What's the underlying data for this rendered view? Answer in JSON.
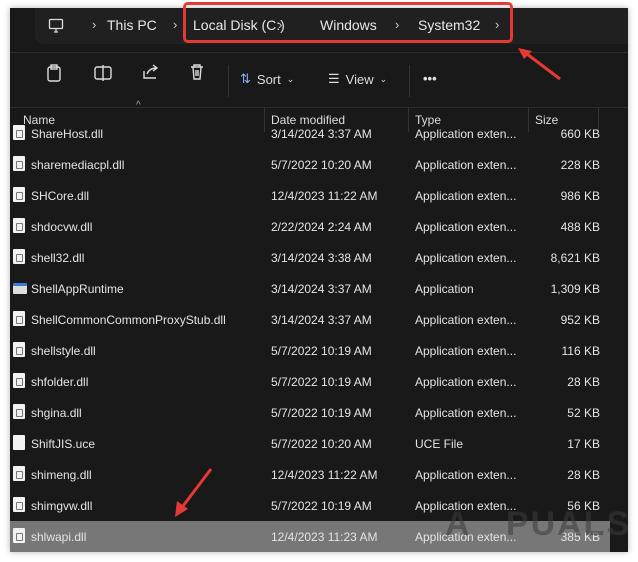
{
  "breadcrumb": [
    "This PC",
    "Local Disk (C:)",
    "Windows",
    "System32"
  ],
  "toolbar": {
    "sort": "Sort",
    "view": "View",
    "more": "•••"
  },
  "columns": {
    "name": "Name",
    "date": "Date modified",
    "type": "Type",
    "size": "Size"
  },
  "files": [
    {
      "name": "ShareHost.dll",
      "date": "3/14/2024 3:37 AM",
      "type": "Application exten...",
      "size": "660 KB",
      "icon": "dll"
    },
    {
      "name": "sharemediacpl.dll",
      "date": "5/7/2022 10:20 AM",
      "type": "Application exten...",
      "size": "228 KB",
      "icon": "dll"
    },
    {
      "name": "SHCore.dll",
      "date": "12/4/2023 11:22 AM",
      "type": "Application exten...",
      "size": "986 KB",
      "icon": "dll"
    },
    {
      "name": "shdocvw.dll",
      "date": "2/22/2024 2:24 AM",
      "type": "Application exten...",
      "size": "488 KB",
      "icon": "dll"
    },
    {
      "name": "shell32.dll",
      "date": "3/14/2024 3:38 AM",
      "type": "Application exten...",
      "size": "8,621 KB",
      "icon": "dll"
    },
    {
      "name": "ShellAppRuntime",
      "date": "3/14/2024 3:37 AM",
      "type": "Application",
      "size": "1,309 KB",
      "icon": "exe"
    },
    {
      "name": "ShellCommonCommonProxyStub.dll",
      "date": "3/14/2024 3:37 AM",
      "type": "Application exten...",
      "size": "952 KB",
      "icon": "dll"
    },
    {
      "name": "shellstyle.dll",
      "date": "5/7/2022 10:19 AM",
      "type": "Application exten...",
      "size": "116 KB",
      "icon": "dll"
    },
    {
      "name": "shfolder.dll",
      "date": "5/7/2022 10:19 AM",
      "type": "Application exten...",
      "size": "28 KB",
      "icon": "dll"
    },
    {
      "name": "shgina.dll",
      "date": "5/7/2022 10:19 AM",
      "type": "Application exten...",
      "size": "52 KB",
      "icon": "dll"
    },
    {
      "name": "ShiftJIS.uce",
      "date": "5/7/2022 10:20 AM",
      "type": "UCE File",
      "size": "17 KB",
      "icon": "file"
    },
    {
      "name": "shimeng.dll",
      "date": "12/4/2023 11:22 AM",
      "type": "Application exten...",
      "size": "28 KB",
      "icon": "dll"
    },
    {
      "name": "shimgvw.dll",
      "date": "5/7/2022 10:19 AM",
      "type": "Application exten...",
      "size": "56 KB",
      "icon": "dll"
    },
    {
      "name": "shlwapi.dll",
      "date": "12/4/2023 11:23 AM",
      "type": "Application exten...",
      "size": "385 KB",
      "icon": "dll",
      "selected": true
    }
  ],
  "watermark": "APPUALS",
  "colors": {
    "highlight": "#e53935",
    "selection": "#777777"
  }
}
